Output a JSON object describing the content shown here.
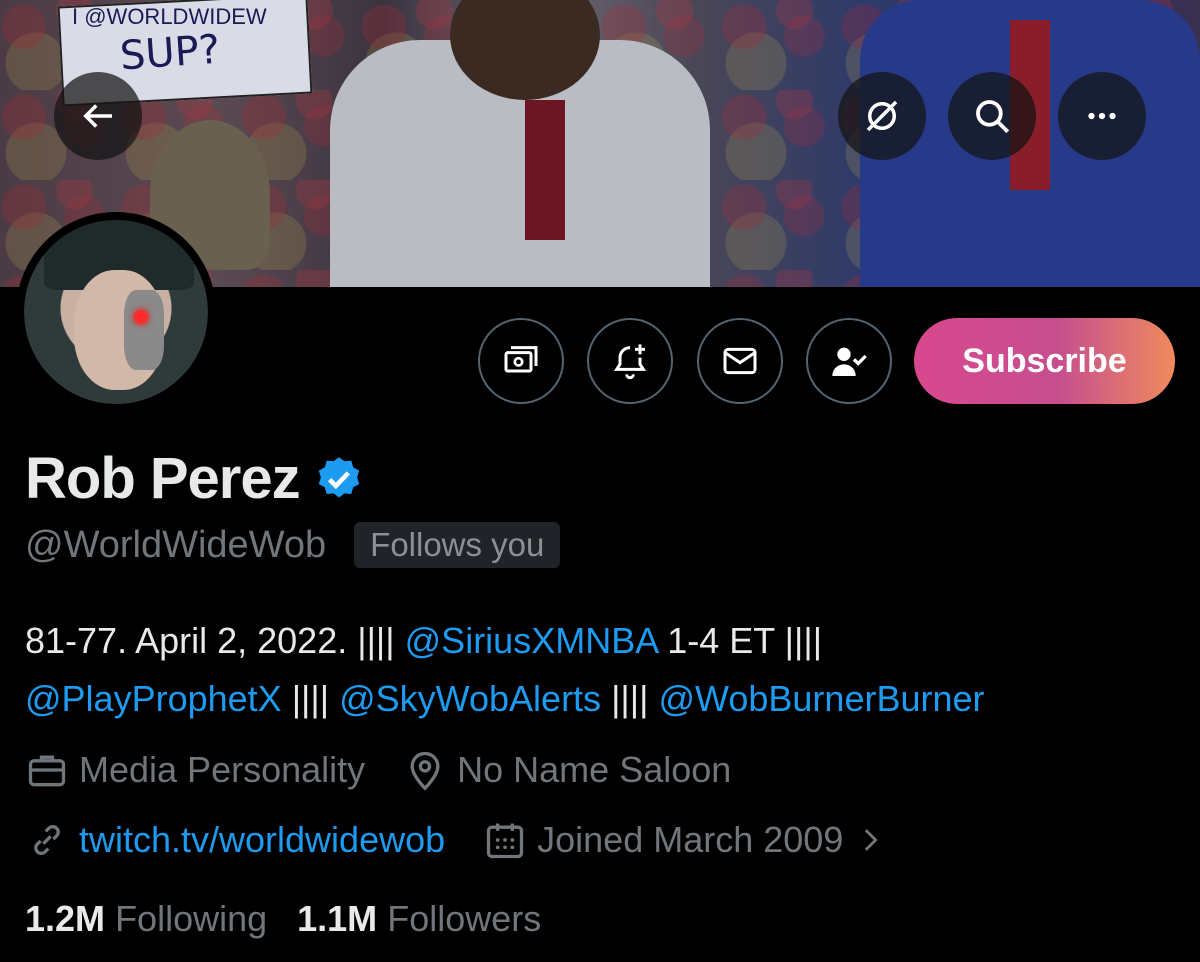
{
  "profile": {
    "name": "Rob Perez",
    "handle": "@WorldWideWob",
    "follows_you": "Follows you",
    "subscribe_label": "Subscribe"
  },
  "banner_sign": {
    "line1": "I @WORLDWIDEW",
    "line2": "SUP?"
  },
  "bio": {
    "part1": "81-77. April 2, 2022. |||| ",
    "mention1": "@SiriusXMNBA",
    "part2": " 1-4 ET ||||",
    "mention2": "@PlayProphetX",
    "sep1": " |||| ",
    "mention3": "@SkyWobAlerts",
    "sep2": " |||| ",
    "mention4": "@WobBurnerBurner"
  },
  "meta": {
    "category": "Media Personality",
    "location": "No Name Saloon",
    "website": "twitch.tv/worldwidewob",
    "joined": "Joined March 2009"
  },
  "stats": {
    "following_count": "1.2M",
    "following_label": "Following",
    "followers_count": "1.1M",
    "followers_label": "Followers"
  },
  "colors": {
    "accent": "#1d9bf0",
    "muted": "#71767b",
    "verified": "#1d9bf0"
  }
}
